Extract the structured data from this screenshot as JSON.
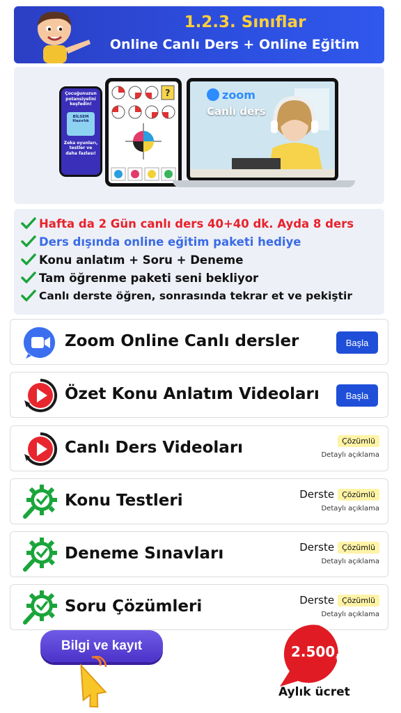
{
  "header": {
    "title": "1.2.3. Sınıflar",
    "subtitle": "Online Canlı Ders + Online Eğitim"
  },
  "hero": {
    "phone_text": "Çocuğunuzun potansiyelini keşfedin!",
    "phone_card": "BİLSEM Hazırlık",
    "phone_text2": "Zeka oyunları, testler ve daha fazlası!",
    "zoom_label": "zoom",
    "canli_ders": "Canlı ders"
  },
  "features": [
    {
      "text": "Hafta da 2 Gün canlı ders 40+40 dk. Ayda 8 ders",
      "color": "#e8222b"
    },
    {
      "text": "Ders dışında online eğitim paketi hediye",
      "color": "#3a6be6"
    },
    {
      "text": "Konu anlatım + Soru + Deneme",
      "color": "#111111"
    },
    {
      "text": "Tam öğrenme paketi seni bekliyor",
      "color": "#111111"
    },
    {
      "text": "Canlı derste öğren, sonrasında tekrar et ve pekiştir",
      "color": "#111111"
    }
  ],
  "cards": [
    {
      "label": "Zoom Online Canlı dersler",
      "icon": "zoom-icon",
      "button": "Başla"
    },
    {
      "label": "Özet Konu Anlatım Videoları",
      "icon": "play-icon",
      "button": "Başla"
    },
    {
      "label": "Canlı Ders Videoları",
      "icon": "play-icon",
      "badge": "Çözümlü",
      "detail": "Detaylı açıklama"
    },
    {
      "label": "Konu Testleri",
      "icon": "gear-check-icon",
      "derste": "Derste",
      "badge": "Çözümlü",
      "detail": "Detaylı açıklama"
    },
    {
      "label": "Deneme Sınavları",
      "icon": "gear-check-icon",
      "derste": "Derste",
      "badge": "Çözümlü",
      "detail": "Detaylı açıklama"
    },
    {
      "label": "Soru Çözümleri",
      "icon": "gear-check-icon",
      "derste": "Derste",
      "badge": "Çözümlü",
      "detail": "Detaylı açıklama"
    }
  ],
  "cta": {
    "label": "Bilgi ve kayıt"
  },
  "price": {
    "amount": "2.500",
    "currency": "₺",
    "label": "Aylık ücret"
  },
  "colors": {
    "header": "#2c4fe0",
    "title_yellow": "#ffcf3a",
    "button_blue": "#1f4fd8",
    "check_green": "#1aa53a",
    "badge_yellow": "#fff3a6",
    "price_red": "#e01b24"
  }
}
